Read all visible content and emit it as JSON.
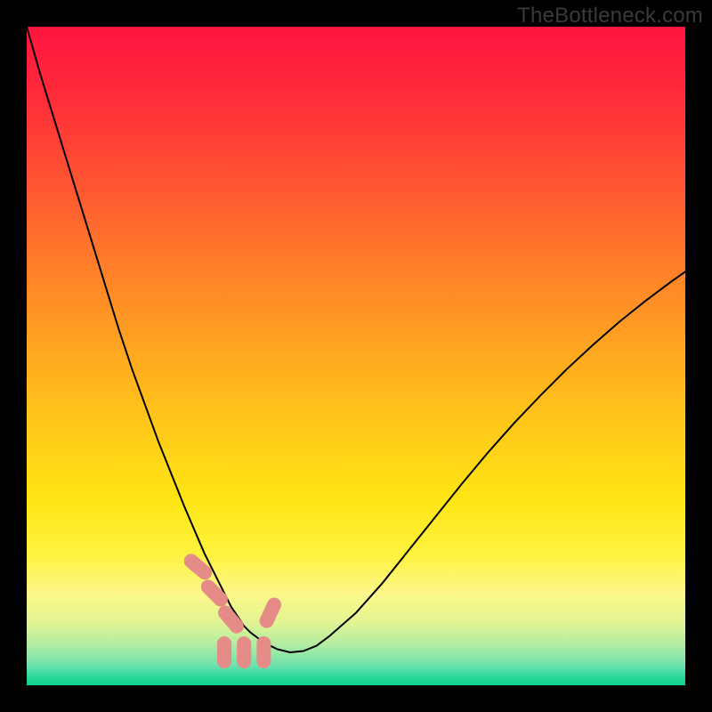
{
  "watermark": "TheBottleneck.com",
  "chart_data": {
    "type": "line",
    "title": "",
    "xlabel": "",
    "ylabel": "",
    "xlim": [
      0,
      100
    ],
    "ylim": [
      0,
      100
    ],
    "x": [
      0,
      2,
      4,
      6,
      8,
      10,
      12,
      14,
      16,
      18,
      20,
      22,
      24,
      25.5,
      27,
      28.5,
      30,
      31,
      32,
      33,
      34,
      36,
      38,
      40,
      42,
      44,
      46,
      50,
      54,
      58,
      62,
      66,
      70,
      74,
      78,
      82,
      86,
      90,
      94,
      98,
      100
    ],
    "values": [
      100,
      93,
      86.5,
      80,
      73.5,
      67,
      60.5,
      54,
      48,
      42.5,
      37,
      32,
      27,
      23.5,
      20,
      17,
      14,
      12,
      10.5,
      9,
      8,
      6.5,
      5.5,
      5,
      5.2,
      6,
      7.5,
      11,
      15.5,
      20.5,
      25.5,
      30.5,
      35.3,
      39.8,
      44,
      48,
      51.7,
      55.2,
      58.4,
      61.4,
      62.8
    ],
    "optimal_zone": {
      "range_x": [
        26,
        37
      ],
      "color_note": "tiny green band at bottom"
    },
    "markers": [
      {
        "x": 26,
        "y": 18,
        "shape": "capsule",
        "angle": 40
      },
      {
        "x": 28.5,
        "y": 14,
        "shape": "capsule",
        "angle": 45
      },
      {
        "x": 31,
        "y": 10,
        "shape": "capsule",
        "angle": 50
      },
      {
        "x": 30,
        "y": 5,
        "shape": "capsule",
        "angle": 90
      },
      {
        "x": 33,
        "y": 5,
        "shape": "capsule",
        "angle": 90
      },
      {
        "x": 36,
        "y": 5,
        "shape": "capsule",
        "angle": 90
      },
      {
        "x": 37,
        "y": 11,
        "shape": "capsule",
        "angle": 115
      }
    ],
    "background_gradient": {
      "type": "vertical",
      "stops": [
        {
          "pos": 0.0,
          "color": "#ff153f"
        },
        {
          "pos": 0.1,
          "color": "#ff2a3a"
        },
        {
          "pos": 0.22,
          "color": "#ff4f33"
        },
        {
          "pos": 0.35,
          "color": "#ff7a2a"
        },
        {
          "pos": 0.48,
          "color": "#ffa321"
        },
        {
          "pos": 0.6,
          "color": "#ffc71a"
        },
        {
          "pos": 0.72,
          "color": "#ffe614"
        },
        {
          "pos": 0.8,
          "color": "#fef23e"
        },
        {
          "pos": 0.86,
          "color": "#fdf889"
        },
        {
          "pos": 0.905,
          "color": "#e1f493"
        },
        {
          "pos": 0.935,
          "color": "#b7eda0"
        },
        {
          "pos": 0.955,
          "color": "#8fe7a8"
        },
        {
          "pos": 0.972,
          "color": "#67e1ae"
        },
        {
          "pos": 0.988,
          "color": "#26d79a"
        },
        {
          "pos": 1.0,
          "color": "#0fcf89"
        }
      ]
    }
  }
}
